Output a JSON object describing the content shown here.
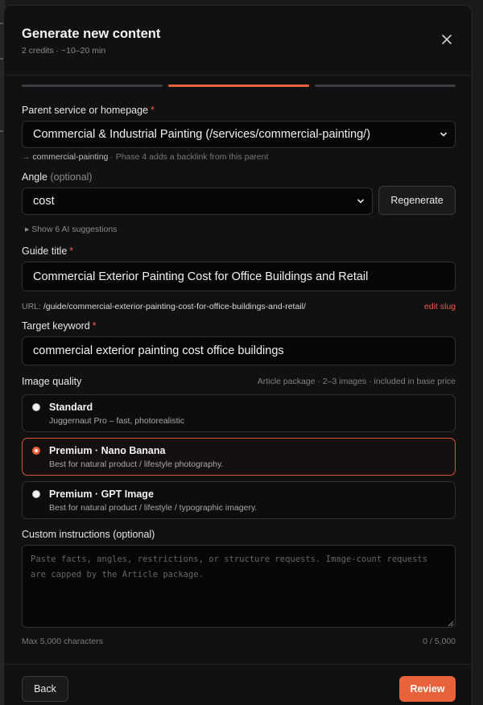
{
  "modal": {
    "title": "Generate new content",
    "subtitle": "2 credits · ~10–20 min"
  },
  "steps": [
    {
      "state": "complete"
    },
    {
      "state": "current"
    },
    {
      "state": "pending"
    }
  ],
  "parent": {
    "label": "Parent service or homepage",
    "selected": "Commercial & Industrial Painting (/services/commercial-painting/)",
    "hint_prefix": "→ ",
    "hint_slug": "commercial-painting",
    "hint_suffix": " · Phase 4 adds a backlink from this parent"
  },
  "angle": {
    "label": "Angle",
    "optional": "(optional)",
    "selected": "cost",
    "regenerate_label": "Regenerate",
    "suggestions_label": "▸ Show 6 AI suggestions"
  },
  "guide_title": {
    "label": "Guide title",
    "value": "Commercial Exterior Painting Cost for Office Buildings and Retail",
    "url_label": "URL: ",
    "url_value": "/guide/commercial-exterior-painting-cost-for-office-buildings-and-retail/",
    "edit_slug_label": "edit slug"
  },
  "keyword": {
    "label": "Target keyword",
    "value": "commercial exterior painting cost office buildings"
  },
  "image_quality": {
    "label": "Image quality",
    "note": "Article package · 2–3 images · included in base price",
    "options": [
      {
        "title": "Standard",
        "desc": "Juggernaut Pro – fast, photorealistic"
      },
      {
        "title": "Premium · Nano Banana",
        "desc": "Best for natural product / lifestyle photography."
      },
      {
        "title": "Premium · GPT Image",
        "desc": "Best for natural product / lifestyle / typographic imagery."
      }
    ],
    "selected_index": 1
  },
  "custom": {
    "label": "Custom instructions (optional)",
    "placeholder": "Paste facts, angles, restrictions, or structure requests. Image-count requests are capped by the Article package.",
    "max_label": "Max 5,000 characters",
    "count": "0 / 5,000"
  },
  "footer": {
    "back_label": "Back",
    "review_label": "Review"
  },
  "colors": {
    "accent": "#e8633a",
    "required": "#ef5a4a",
    "background": "#111111"
  },
  "icons": {
    "close": "close-icon",
    "select_arrow": "chevron-down-icon",
    "resize": "resize-grip-icon"
  }
}
